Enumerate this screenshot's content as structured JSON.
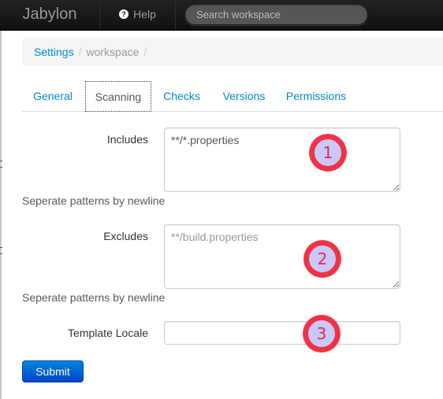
{
  "navbar": {
    "brand": "Jabylon",
    "help_label": "Help",
    "help_icon": "question-circle-icon",
    "search_placeholder": "Search workspace"
  },
  "breadcrumb": {
    "items": [
      "Settings",
      "workspace"
    ],
    "separator": "/"
  },
  "tabs": [
    {
      "label": "General",
      "active": false
    },
    {
      "label": "Scanning",
      "active": true
    },
    {
      "label": "Checks",
      "active": false
    },
    {
      "label": "Versions",
      "active": false
    },
    {
      "label": "Permissions",
      "active": false
    }
  ],
  "form": {
    "includes": {
      "label": "Includes",
      "value": "**/*.properties",
      "help": "Seperate patterns by newline"
    },
    "excludes": {
      "label": "Excludes",
      "value": "",
      "placeholder": "**/build.properties",
      "help": "Seperate patterns by newline"
    },
    "template_locale": {
      "label": "Template Locale",
      "value": ""
    },
    "submit_label": "Submit"
  },
  "annotations": [
    "1",
    "2",
    "3"
  ],
  "colors": {
    "link": "#0088cc",
    "navbar": "#1b1b1b",
    "primary_button": "#0066cc",
    "marker_ring": "#ee3344",
    "marker_fill": "#c8c8fa"
  }
}
